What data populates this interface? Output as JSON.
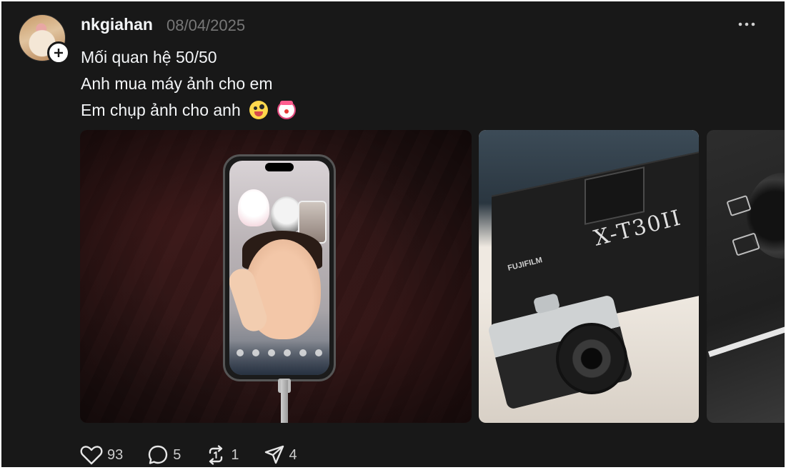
{
  "post": {
    "username": "nkgiahan",
    "date": "08/04/2025",
    "caption_lines": [
      "Mối quan hệ 50/50",
      "Anh mua máy ảnh cho em",
      "Em chụp ảnh cho anh"
    ],
    "caption_emojis": [
      "zany-face-emoji",
      "clown-face-emoji"
    ],
    "media": [
      "phone-on-fabric",
      "fujifilm-box-and-camera",
      "camera-box-side"
    ],
    "box_text": {
      "model": "X-T30II",
      "brand": "FUJIFILM"
    }
  },
  "actions": {
    "likes": "93",
    "replies": "5",
    "reposts": "1",
    "shares": "4"
  },
  "icons": {
    "more": "more-horizontal-icon",
    "follow": "plus-icon",
    "like": "heart-icon",
    "reply": "comment-icon",
    "repost": "repost-icon",
    "share": "send-icon"
  },
  "colors": {
    "background": "#181818",
    "text": "#f3f5f7",
    "muted": "#777777"
  }
}
